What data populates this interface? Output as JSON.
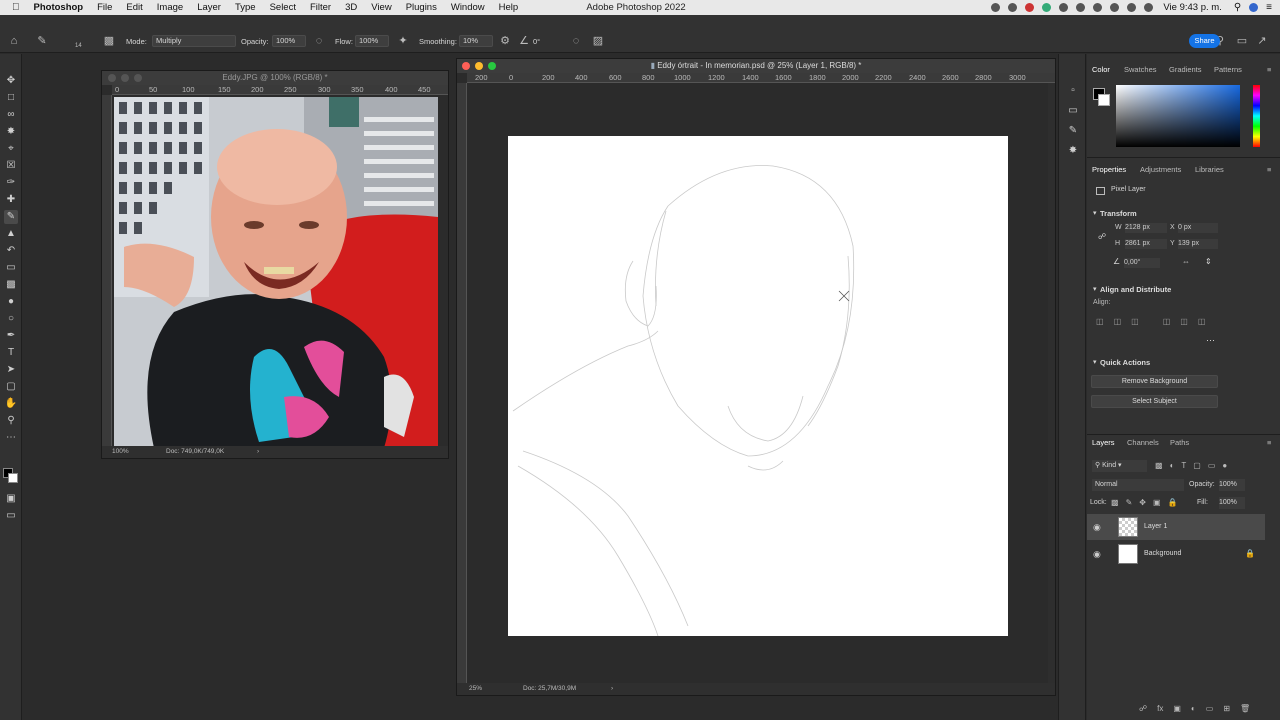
{
  "menubar": {
    "app_name": "Photoshop",
    "items": [
      "File",
      "Edit",
      "Image",
      "Layer",
      "Type",
      "Select",
      "Filter",
      "3D",
      "View",
      "Plugins",
      "Window",
      "Help"
    ],
    "center_title": "Adobe Photoshop 2022",
    "clock": "Vie 9:43 p. m."
  },
  "options": {
    "brush_size": "14",
    "mode_label": "Mode:",
    "mode_value": "Multiply",
    "opacity_label": "Opacity:",
    "opacity_value": "100%",
    "flow_label": "Flow:",
    "flow_value": "100%",
    "smoothing_label": "Smoothing:",
    "smoothing_value": "10%",
    "angle_value": "0°",
    "share_label": "Share"
  },
  "doc1": {
    "title": "Eddy.JPG @ 100% (RGB/8) *",
    "ruler_h": [
      "0",
      "50",
      "100",
      "150",
      "200",
      "250",
      "300",
      "350",
      "400",
      "450"
    ],
    "zoom": "100%",
    "doc_size": "Doc: 749,0K/749,0K"
  },
  "doc2": {
    "title": "Eddy órtrait - In memorian.psd @ 25% (Layer 1, RGB/8) *",
    "ruler_h": [
      "200",
      "0",
      "200",
      "400",
      "600",
      "800",
      "1000",
      "1200",
      "1400",
      "1600",
      "1800",
      "2000",
      "2200",
      "2400",
      "2600",
      "2800",
      "3000"
    ],
    "zoom": "25%",
    "doc_size": "Doc: 25,7M/30,9M"
  },
  "panels": {
    "color_tabs": [
      "Color",
      "Swatches",
      "Gradients",
      "Patterns"
    ],
    "props_tabs": [
      "Properties",
      "Adjustments",
      "Libraries"
    ],
    "pixel_layer": "Pixel Layer",
    "transform_title": "Transform",
    "w_label": "W",
    "w_value": "2128 px",
    "x_label": "X",
    "x_value": "0 px",
    "h_label": "H",
    "h_value": "2861 px",
    "y_label": "Y",
    "y_value": "139 px",
    "angle_value": "0,00°",
    "align_title": "Align and Distribute",
    "align_label": "Align:",
    "quick_title": "Quick Actions",
    "remove_bg": "Remove Background",
    "select_subject": "Select Subject",
    "layers_tabs": [
      "Layers",
      "Channels",
      "Paths"
    ],
    "kind_label": "Kind",
    "blend_mode": "Normal",
    "opacity_label": "Opacity:",
    "opacity_value": "100%",
    "lock_label": "Lock:",
    "fill_label": "Fill:",
    "fill_value": "100%",
    "layers": [
      "Layer 1",
      "Background"
    ]
  },
  "colors": {
    "accent": "#1473e6",
    "panel_bg": "#323232",
    "workspace_bg": "#2b2b2b"
  }
}
